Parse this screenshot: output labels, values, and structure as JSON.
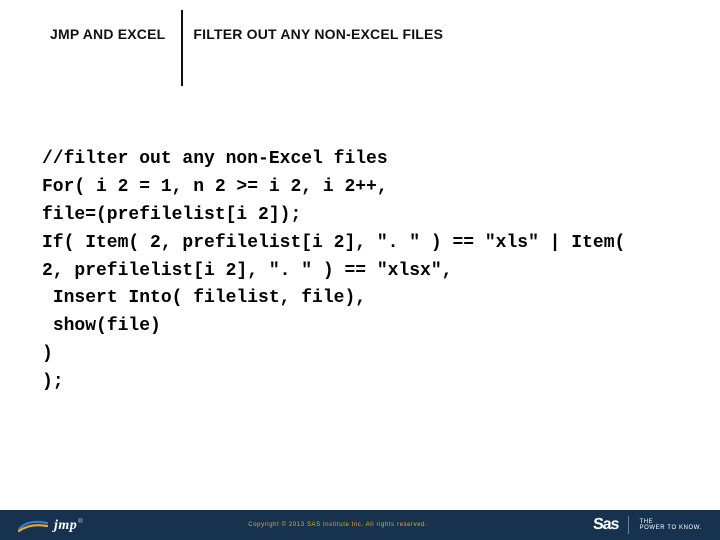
{
  "header": {
    "left": "JMP AND EXCEL",
    "right": "FILTER OUT ANY NON-EXCEL FILES"
  },
  "code": {
    "l1": "//filter out any non-Excel files",
    "l2": "For( i 2 = 1, n 2 >= i 2, i 2++,",
    "l3": "file=(prefilelist[i 2]);",
    "l4": "If( Item( 2, prefilelist[i 2], \". \" ) == \"xls\" | Item(",
    "l5": "2, prefilelist[i 2], \". \" ) == \"xlsx\",",
    "l6": " Insert Into( filelist, file),",
    "l7": " show(file)",
    "l8": ")",
    "l9": ");"
  },
  "footer": {
    "logo_text": "jmp",
    "trademark": "®",
    "copyright": "Copyright © 2013  SAS Institute Inc.  All rights reserved.",
    "sas": "Sas",
    "tagline_top": "THE",
    "tagline_bottom": "POWER TO KNOW."
  }
}
